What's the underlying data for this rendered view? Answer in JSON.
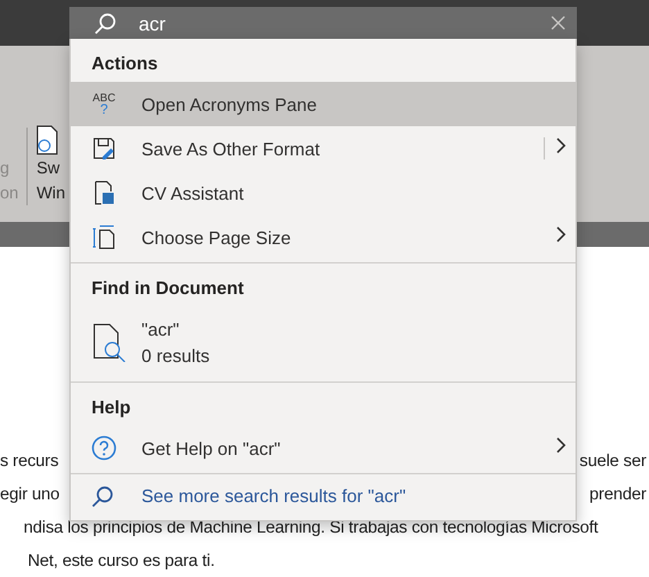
{
  "ribbon": [
    {
      "lines": [
        "g",
        "on"
      ],
      "disabled": true
    },
    {
      "lines": [
        "Sw",
        "Win"
      ],
      "disabled": false
    }
  ],
  "document": {
    "lines": [
      {
        "left": "s recurs",
        "right": "suele ser"
      },
      {
        "left": "egir uno",
        "right": "prender"
      },
      {
        "left": "ndisa los principios de Machine Learning. Si trabajas con tecnologías Microsoft"
      },
      {
        "left": "Net, este curso es para ti."
      }
    ]
  },
  "search": {
    "value": "acr"
  },
  "sections": [
    {
      "title": "Actions",
      "items": [
        {
          "kind": "action",
          "icon_text": [
            "ABC",
            "?"
          ],
          "label": "Open Acronyms Pane",
          "selected": true,
          "submenu": false,
          "split": false
        },
        {
          "kind": "action",
          "label": "Save As Other Format",
          "selected": false,
          "submenu": true,
          "split": true
        },
        {
          "kind": "action",
          "label": "CV Assistant",
          "selected": false,
          "submenu": false,
          "split": false
        },
        {
          "kind": "action",
          "label": "Choose Page Size",
          "selected": false,
          "submenu": true,
          "split": false
        }
      ]
    },
    {
      "title": "Find in Document",
      "items": [
        {
          "kind": "result",
          "label": "\"acr\"",
          "detail": "0 results",
          "selected": false
        }
      ]
    },
    {
      "title": "Help",
      "items": [
        {
          "kind": "action",
          "label": "Get Help on \"acr\"",
          "selected": false,
          "submenu": true,
          "split": false
        }
      ]
    }
  ],
  "more_link": "See more search results for \"acr\""
}
